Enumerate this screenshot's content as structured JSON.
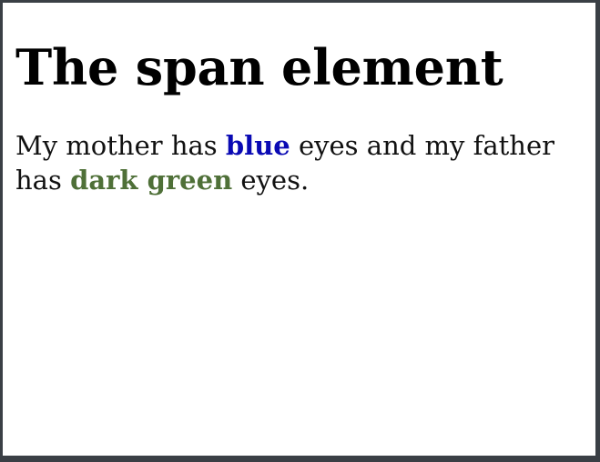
{
  "page": {
    "heading": "The span element",
    "paragraph": {
      "text1": "My mother has ",
      "span1": "blue",
      "text2": " eyes and my father has ",
      "span2": "dark green",
      "text3": " eyes."
    }
  },
  "colors": {
    "blue_span": "#0a0ab4",
    "dark_green_span": "#4f7038",
    "frame": "#3a3f45",
    "background": "#ffffff"
  }
}
